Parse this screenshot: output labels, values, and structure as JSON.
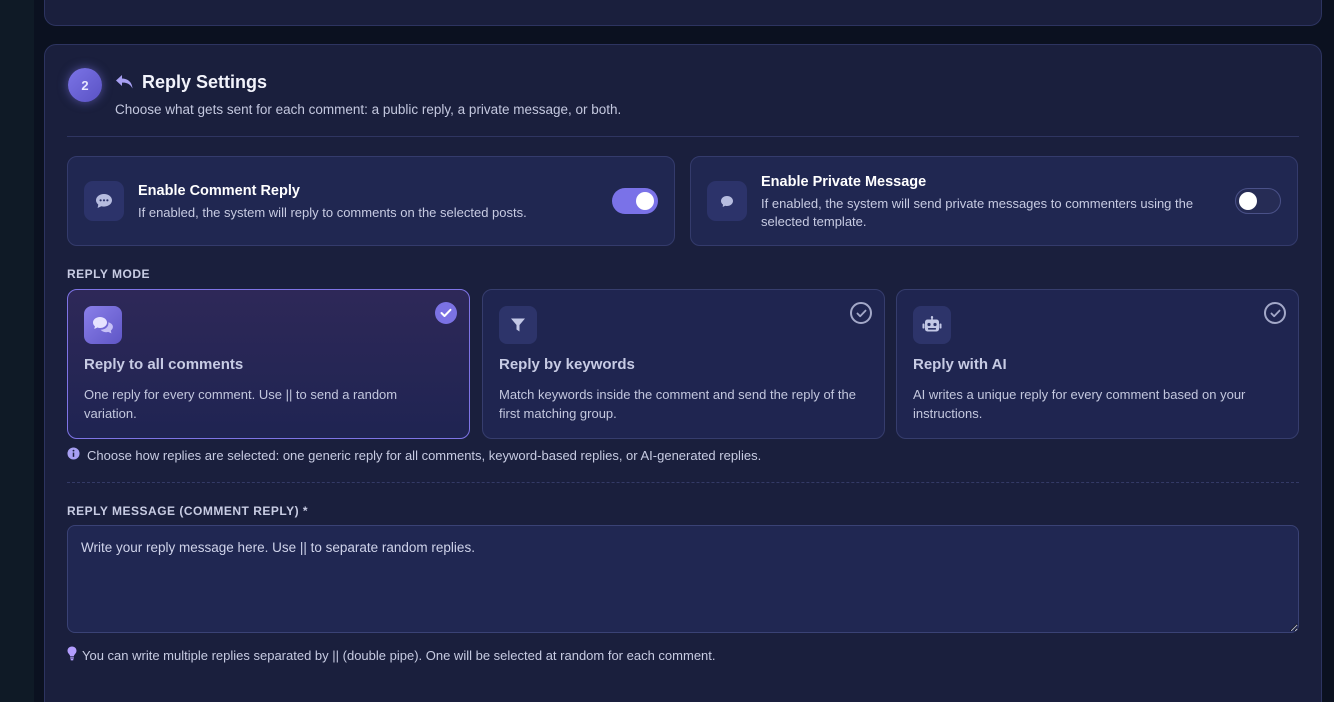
{
  "settings": {
    "step_number": "2",
    "title": "Reply Settings",
    "subtitle": "Choose what gets sent for each comment: a public reply, a private message, or both."
  },
  "toggles": [
    {
      "title": "Enable Comment Reply",
      "description": "If enabled, the system will reply to comments on the selected posts.",
      "enabled": true,
      "icon": "comment-dots-icon"
    },
    {
      "title": "Enable Private Message",
      "description": "If enabled, the system will send private messages to commenters using the selected template.",
      "enabled": false,
      "icon": "messenger-icon"
    }
  ],
  "reply_mode": {
    "label": "REPLY MODE",
    "options": [
      {
        "title": "Reply to all comments",
        "description": "One reply for every comment. Use || to send a random variation.",
        "selected": true,
        "icon": "comments-icon"
      },
      {
        "title": "Reply by keywords",
        "description": "Match keywords inside the comment and send the reply of the first matching group.",
        "selected": false,
        "icon": "filter-icon"
      },
      {
        "title": "Reply with AI",
        "description": "AI writes a unique reply for every comment based on your instructions.",
        "selected": false,
        "icon": "robot-icon"
      }
    ],
    "hint": "Choose how replies are selected: one generic reply for all comments, keyword-based replies, or AI-generated replies."
  },
  "reply_message": {
    "label": "REPLY MESSAGE (COMMENT REPLY) *",
    "placeholder": "Write your reply message here. Use || to separate random replies.",
    "value": "",
    "hint": "You can write multiple replies separated by || (double pipe). One will be selected at random for each comment."
  },
  "colors": {
    "accent": "#7a72e8",
    "card_bg": "#1a1f3d",
    "inner_card_bg": "#202751",
    "page_bg": "#0b1120"
  }
}
